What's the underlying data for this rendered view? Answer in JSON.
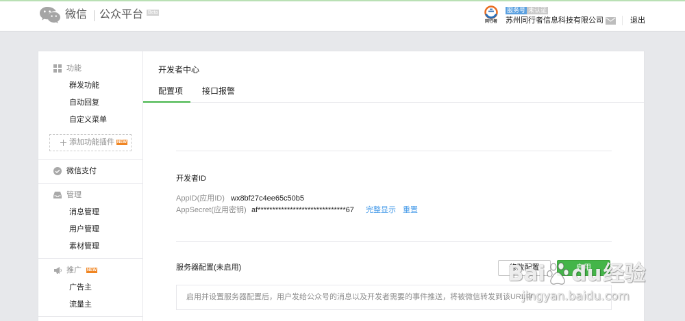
{
  "theme": {
    "brand_green": "#44b549",
    "link_blue": "#459ae9",
    "service_badge_blue": "#5aa0e0",
    "unverified_badge_gray": "#c9c9c9",
    "new_badge_orange": "#f08522"
  },
  "header": {
    "logo": {
      "icon": "wechat-logo-icon",
      "wechat": "微信",
      "platform": "公众平台",
      "beta": "Beta"
    },
    "account": {
      "logo_icon": "company-logo-icon",
      "logo_text": "同行者",
      "type_badge": "服务号",
      "verify_badge": "未认证",
      "name": "苏州同行者信息科技有限公司"
    },
    "mail_icon": "mail-icon",
    "logout_label": "退出"
  },
  "sidebar": {
    "function": {
      "icon": "grid-icon",
      "title": "功能",
      "items": [
        "群发功能",
        "自动回复",
        "自定义菜单"
      ],
      "add_plugin_icon": "plus-icon",
      "add_plugin_label": "添加功能插件",
      "add_plugin_badge": "NEW"
    },
    "payment": {
      "icon": "wechat-pay-icon",
      "title": "微信支付"
    },
    "manage": {
      "icon": "inbox-icon",
      "title": "管理",
      "items": [
        "消息管理",
        "用户管理",
        "素材管理"
      ]
    },
    "promote": {
      "icon": "megaphone-icon",
      "title": "推广",
      "badge": "NEW",
      "items": [
        "广告主",
        "流量主"
      ]
    }
  },
  "main": {
    "title": "开发者中心",
    "tabs": [
      {
        "label": "配置项",
        "active": true
      },
      {
        "label": "接口报警",
        "active": false
      }
    ],
    "developer_id": {
      "heading": "开发者ID",
      "appid_label": "AppID(应用ID)",
      "appid_value": "wx8bf27c4ee65c50b5",
      "secret_label": "AppSecret(应用密钥)",
      "secret_value": "af******************************67",
      "show_full_label": "完整显示",
      "reset_label": "重置"
    },
    "server_config": {
      "heading": "服务器配置(未启用)",
      "modify_label": "修改配置",
      "enable_label": "启用",
      "description": "启用并设置服务器配置后，用户发给公众号的消息以及开发者需要的事件推送，将被微信转发到该URL中"
    }
  },
  "watermark": {
    "brand_left": "Bai",
    "paw_icon": "baidu-paw-icon",
    "brand_right": "du",
    "product": "经验",
    "url": "jingyan.baidu.com"
  }
}
